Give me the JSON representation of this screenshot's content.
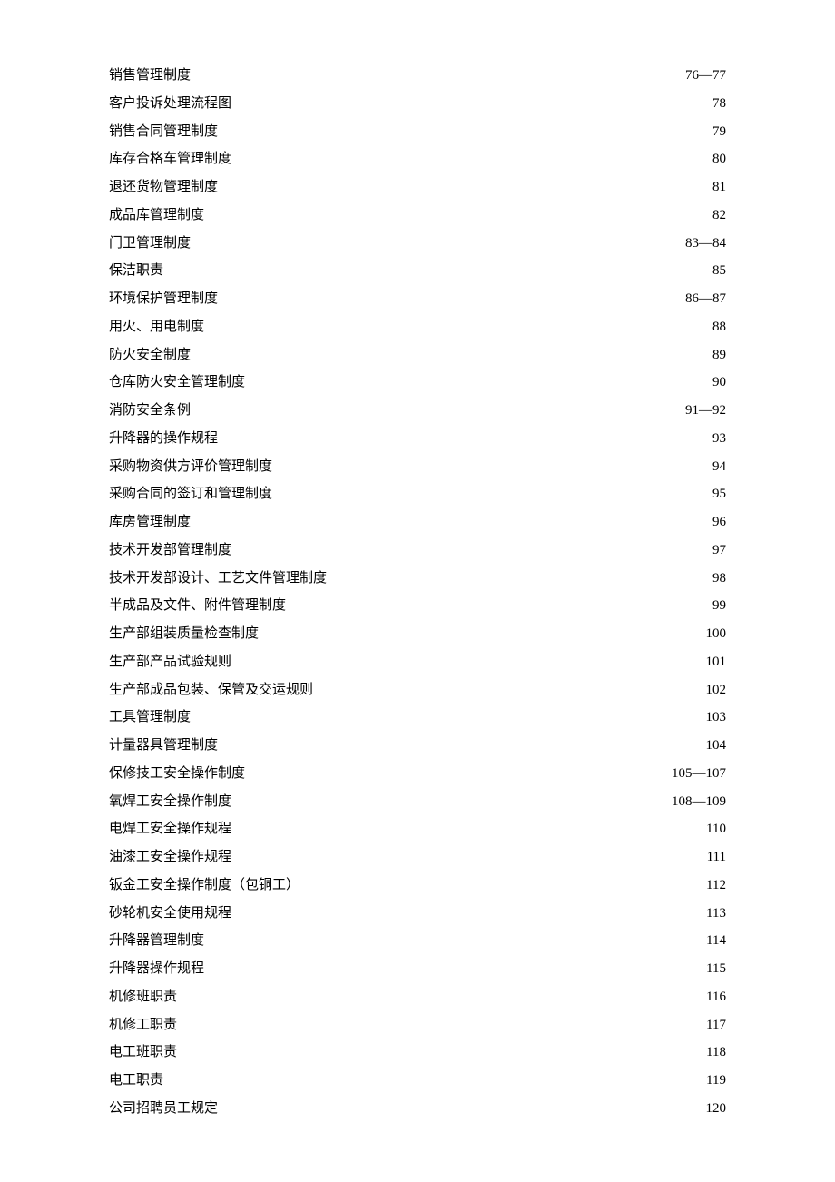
{
  "toc": [
    {
      "title": "销售管理制度",
      "page": "76—77"
    },
    {
      "title": "客户投诉处理流程图",
      "page": "78"
    },
    {
      "title": "销售合同管理制度",
      "page": "79"
    },
    {
      "title": "库存合格车管理制度",
      "page": "80"
    },
    {
      "title": "退还货物管理制度",
      "page": "81"
    },
    {
      "title": "成品库管理制度",
      "page": "82"
    },
    {
      "title": "门卫管理制度",
      "page": "83—84"
    },
    {
      "title": "保洁职责",
      "page": "85"
    },
    {
      "title": "环境保护管理制度",
      "page": "86—87"
    },
    {
      "title": "用火、用电制度",
      "page": "88"
    },
    {
      "title": "防火安全制度",
      "page": "89"
    },
    {
      "title": "仓库防火安全管理制度",
      "page": "90"
    },
    {
      "title": "消防安全条例",
      "page": "91—92"
    },
    {
      "title": "升降器的操作规程",
      "page": "93"
    },
    {
      "title": "采购物资供方评价管理制度",
      "page": "94"
    },
    {
      "title": "采购合同的签订和管理制度",
      "page": "95"
    },
    {
      "title": "库房管理制度",
      "page": "96"
    },
    {
      "title": "技术开发部管理制度",
      "page": "97"
    },
    {
      "title": "技术开发部设计、工艺文件管理制度",
      "page": "98"
    },
    {
      "title": "半成品及文件、附件管理制度",
      "page": "99"
    },
    {
      "title": "生产部组装质量检查制度",
      "page": "100"
    },
    {
      "title": "生产部产品试验规则",
      "page": "101"
    },
    {
      "title": "生产部成品包装、保管及交运规则",
      "page": "102"
    },
    {
      "title": "工具管理制度",
      "page": "103"
    },
    {
      "title": "计量器具管理制度",
      "page": "104"
    },
    {
      "title": "保修技工安全操作制度",
      "page": "105—107"
    },
    {
      "title": "氧焊工安全操作制度",
      "page": "108—109"
    },
    {
      "title": "电焊工安全操作规程",
      "page": "110"
    },
    {
      "title": "油漆工安全操作规程",
      "page": "111"
    },
    {
      "title": "钣金工安全操作制度（包铜工）",
      "page": "112"
    },
    {
      "title": "砂轮机安全使用规程",
      "page": "113"
    },
    {
      "title": "升降器管理制度",
      "page": "114"
    },
    {
      "title": "升降器操作规程",
      "page": "115"
    },
    {
      "title": "机修班职责",
      "page": "116"
    },
    {
      "title": "机修工职责",
      "page": "117"
    },
    {
      "title": "电工班职责",
      "page": "118"
    },
    {
      "title": "电工职责",
      "page": "119"
    },
    {
      "title": "公司招聘员工规定",
      "page": "120"
    }
  ]
}
